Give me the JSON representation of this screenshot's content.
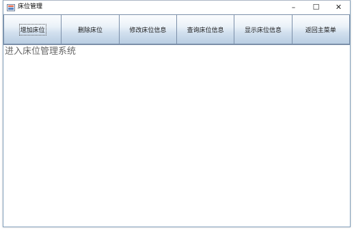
{
  "window": {
    "title": "床位管理",
    "icon": "java-app-icon",
    "controls": {
      "minimize": "–",
      "maximize": "☐",
      "close": "✕"
    }
  },
  "toolbar": {
    "buttons": [
      {
        "label": "增加床位",
        "icon": "",
        "focused": true
      },
      {
        "label": "删除床位"
      },
      {
        "label": "修改床位信息"
      },
      {
        "label": "查询床位信息"
      },
      {
        "label": "显示床位信息"
      },
      {
        "label": "返回主菜单"
      }
    ]
  },
  "content": {
    "message": "进入床位管理系统"
  },
  "colors": {
    "border": "#7a8ea8",
    "message_text": "#666666"
  }
}
